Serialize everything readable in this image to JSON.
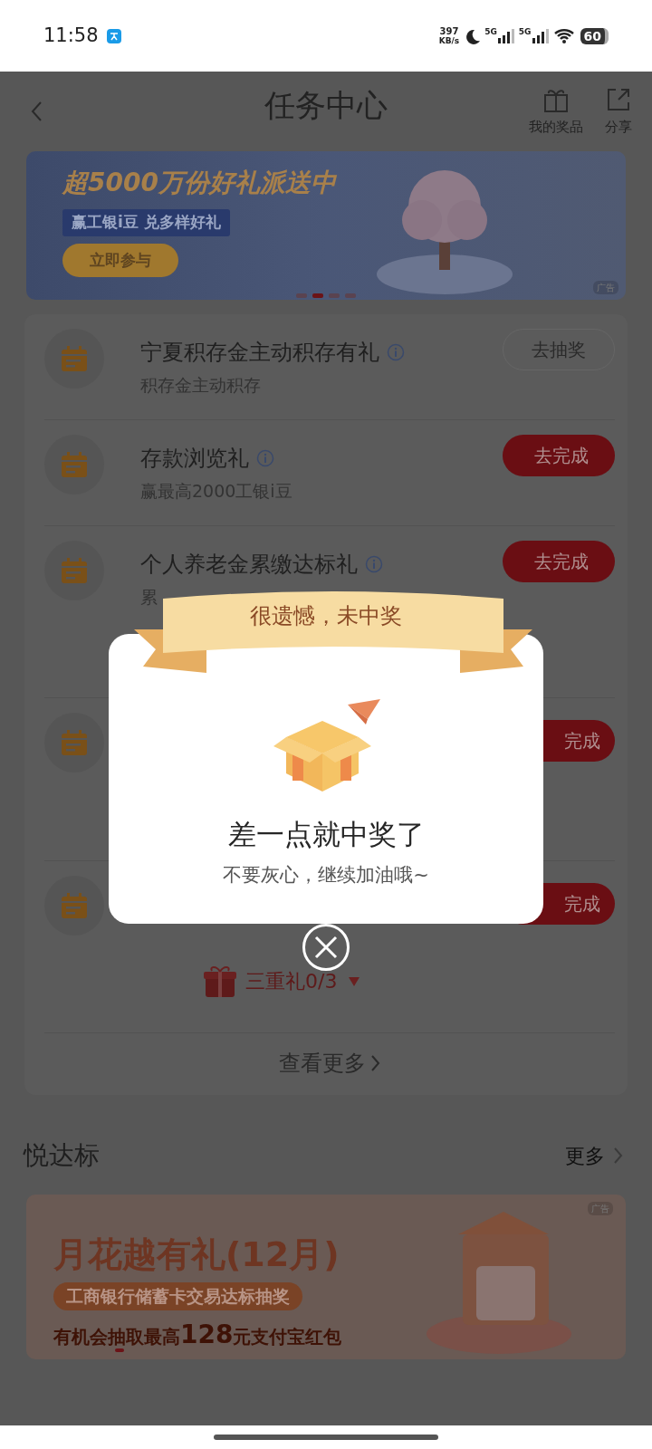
{
  "status_bar": {
    "time": "11:58",
    "speed": "397",
    "speed_unit": "KB/s",
    "network_1": "5G",
    "network_2": "5G",
    "battery": "60"
  },
  "header": {
    "title": "任务中心",
    "actions": [
      {
        "label": "我的奖品",
        "kind": "gift"
      },
      {
        "label": "分享",
        "kind": "share"
      }
    ]
  },
  "top_banner": {
    "headline": "超5000万份好礼派送中",
    "tagline": "赢工银i豆 兑多样好礼",
    "cta": "立即参与",
    "ad_tag": "广告",
    "pages": [
      {
        "selected": false
      },
      {
        "selected": true
      },
      {
        "selected": false
      },
      {
        "selected": false
      }
    ]
  },
  "tasks": [
    {
      "title": "宁夏积存金主动积存有礼",
      "info": true,
      "subtitle": "积存金主动积存",
      "button": "去抽奖",
      "kind": "outline"
    },
    {
      "title": "存款浏览礼",
      "info": true,
      "subtitle": "赢最高2000工银i豆",
      "button": "去完成",
      "kind": "filled"
    },
    {
      "title": "个人养老金累缴达标礼",
      "info": true,
      "subtitle": "累",
      "button": "去完成",
      "kind": "filled"
    },
    {
      "button": "完成",
      "kind": "filled"
    },
    {
      "button": "完成",
      "kind": "filled",
      "bonus": "三重礼0/3"
    }
  ],
  "more_link": "查看更多",
  "section": {
    "title": "悦达标",
    "more": "更多"
  },
  "promo_banner": {
    "headline": "月花越有礼(12月)",
    "tagline": "工商银行储蓄卡交易达标抽奖",
    "detail": "有机会抽取最高**128**元支付宝红包",
    "ad_tag": "广告",
    "pages": [
      {
        "selected": true
      }
    ]
  },
  "dialog": {
    "ribbon": "很遗憾，未中奖",
    "headline": "差一点就中奖了",
    "message": "不要灰心，继续加油哦~"
  }
}
